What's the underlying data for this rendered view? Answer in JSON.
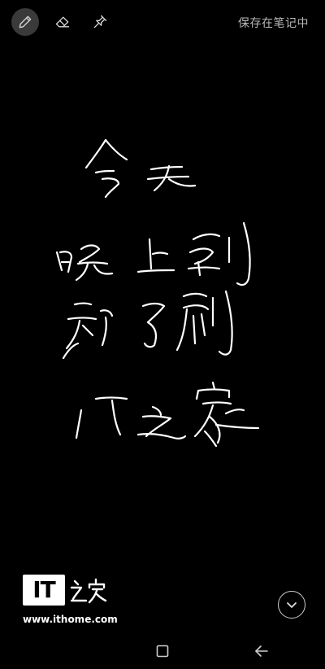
{
  "toolbar": {
    "tools": [
      {
        "name": "pen",
        "icon": "pen-icon",
        "active": true
      },
      {
        "name": "eraser",
        "icon": "eraser-icon",
        "active": false
      },
      {
        "name": "pin",
        "icon": "pin-icon",
        "active": false
      }
    ],
    "save_label": "保存在笔记中"
  },
  "canvas": {
    "handwriting_text": "今天晚上刷新了刷IT之家",
    "ink_color": "#ffffff",
    "background_color": "#000000"
  },
  "watermark": {
    "logo_text": "IT之家",
    "url": "www.ithome.com"
  },
  "controls": {
    "collapse_icon": "chevron-down-icon"
  },
  "navbar": {
    "recent_icon": "recent-apps-icon",
    "back_icon": "back-arrow-icon"
  }
}
